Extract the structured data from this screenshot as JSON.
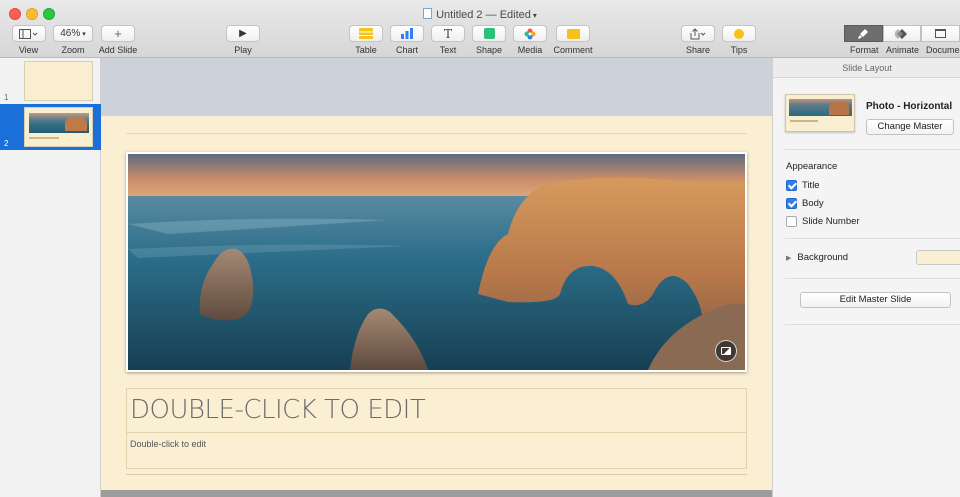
{
  "window": {
    "title": "Untitled 2",
    "title_separator": "—",
    "status": "Edited",
    "traffic_lights": {
      "close": "#fc5f57",
      "minimize": "#fdbc2e",
      "maximize": "#28c940"
    }
  },
  "toolbar": {
    "view_label": "View",
    "zoom_value": "46%",
    "zoom_label": "Zoom",
    "add_slide_label": "Add Slide",
    "play_label": "Play",
    "table_label": "Table",
    "chart_label": "Chart",
    "text_label": "Text",
    "shape_label": "Shape",
    "media_label": "Media",
    "comment_label": "Comment",
    "share_label": "Share",
    "tips_label": "Tips",
    "format_label": "Format",
    "animate_label": "Animate",
    "document_label": "Document",
    "accent_color": "#f6c11a"
  },
  "navigator": {
    "slides": [
      {
        "number": "1",
        "selected": false
      },
      {
        "number": "2",
        "selected": true
      }
    ],
    "selection_color": "#1a6fd8"
  },
  "slide": {
    "title_placeholder": "DOUBLE-CLICK TO EDIT",
    "body_placeholder": "Double-click to edit",
    "background_color": "#faefd2"
  },
  "inspector": {
    "panel_title": "Slide Layout",
    "master_name": "Photo - Horizontal",
    "change_master_label": "Change Master",
    "appearance_heading": "Appearance",
    "options": [
      {
        "label": "Title",
        "checked": true
      },
      {
        "label": "Body",
        "checked": true
      },
      {
        "label": "Slide Number",
        "checked": false
      }
    ],
    "background_label": "Background",
    "background_swatch": "#faefd2",
    "edit_master_label": "Edit Master Slide"
  }
}
